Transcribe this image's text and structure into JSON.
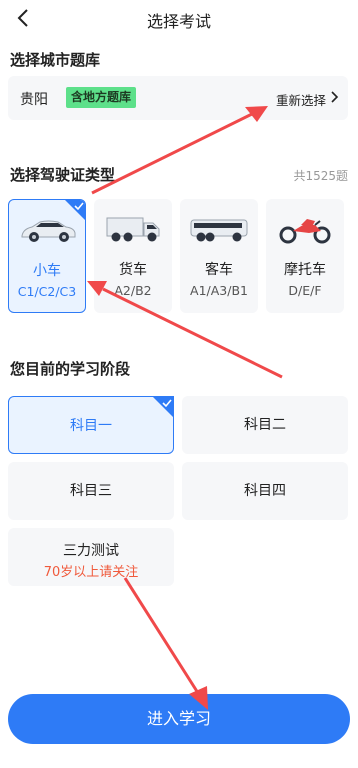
{
  "header": {
    "title": "选择考试"
  },
  "city_section": {
    "title": "选择城市题库",
    "city": "贵阳",
    "badge": "含地方题库",
    "reselect_label": "重新选择"
  },
  "license_section": {
    "title": "选择驾驶证类型",
    "total": "共1525题",
    "types": [
      {
        "name": "小车",
        "codes": "C1/C2/C3",
        "selected": true
      },
      {
        "name": "货车",
        "codes": "A2/B2",
        "selected": false
      },
      {
        "name": "客车",
        "codes": "A1/A3/B1",
        "selected": false
      },
      {
        "name": "摩托车",
        "codes": "D/E/F",
        "selected": false
      }
    ]
  },
  "stage_section": {
    "title": "您目前的学习阶段",
    "stages": [
      {
        "label": "科目一",
        "selected": true
      },
      {
        "label": "科目二",
        "selected": false
      },
      {
        "label": "科目三",
        "selected": false
      },
      {
        "label": "科目四",
        "selected": false
      }
    ],
    "special": {
      "label": "三力测试",
      "note": "70岁以上请关注"
    }
  },
  "enter_button": {
    "label": "进入学习"
  },
  "colors": {
    "accent": "#2e7bf6",
    "badge_green": "#5de08a",
    "note_red": "#f05a3c",
    "card_bg": "#f6f7f9",
    "annotation_arrow": "#f0494a"
  }
}
